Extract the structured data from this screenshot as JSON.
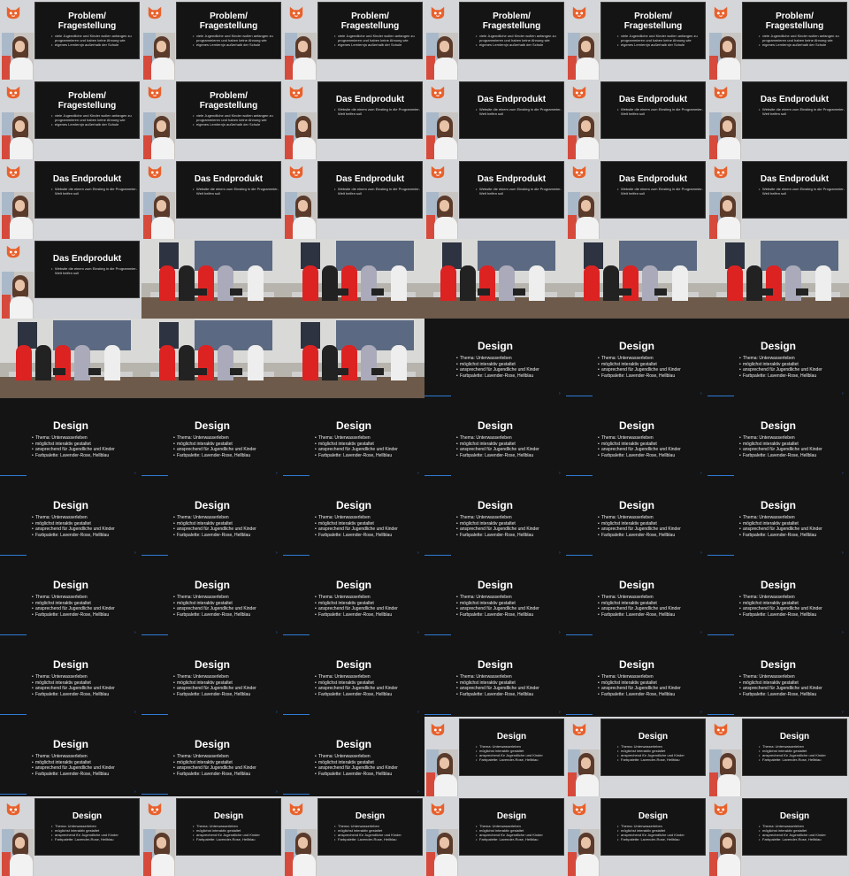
{
  "slides": {
    "problem": {
      "title": "Problem/ Fragestellung",
      "bullets": [
        "viele Jugendliche und Kinder wollen anfangen zu programmieren und haben keine Ahnung wie",
        "eigenes Lernlernjn außerhalb der Schule"
      ]
    },
    "endprodukt": {
      "title": "Das Endprodukt",
      "bullets": [
        "Website die einem zum Einstieg in die Programmier- Welt helfen soll"
      ]
    },
    "design": {
      "title": "Design",
      "bullets": [
        "Thema: Unterwasserleben",
        "möglichst interaktiv gestaltet",
        "ansprechend für Jugendliche und Kinder",
        "Farbpalette: Lavender-Rose, Hellblau"
      ]
    }
  },
  "colors": {
    "slide_bg": "#141414",
    "frame_bg": "#d4d6d9",
    "logo_orange": "#e8612c",
    "accent_blue": "#2f7bd6"
  },
  "icons": {
    "logo": "fox-logo-icon"
  },
  "tiles": [
    "A-problem",
    "A-problem",
    "A-problem",
    "A-problem",
    "A-problem",
    "A-problem",
    "A-problem",
    "A-problem",
    "A-endprodukt",
    "A-endprodukt",
    "A-endprodukt",
    "A-endprodukt",
    "A-endprodukt",
    "A-endprodukt",
    "A-endprodukt",
    "A-endprodukt",
    "A-endprodukt",
    "A-endprodukt",
    "A-endprodukt",
    "B",
    "B",
    "B",
    "B",
    "B",
    "B",
    "B",
    "B",
    "C",
    "C",
    "C",
    "C",
    "C",
    "C",
    "C",
    "C",
    "C",
    "C",
    "C",
    "C",
    "C",
    "C",
    "C",
    "C",
    "C",
    "C",
    "C",
    "C",
    "C",
    "C",
    "C",
    "C",
    "C",
    "C",
    "C",
    "C",
    "C",
    "C",
    "A-design",
    "A-design",
    "A-design",
    "A-design",
    "A-design",
    "A-design",
    "A-design",
    "A-design",
    "A-design"
  ]
}
